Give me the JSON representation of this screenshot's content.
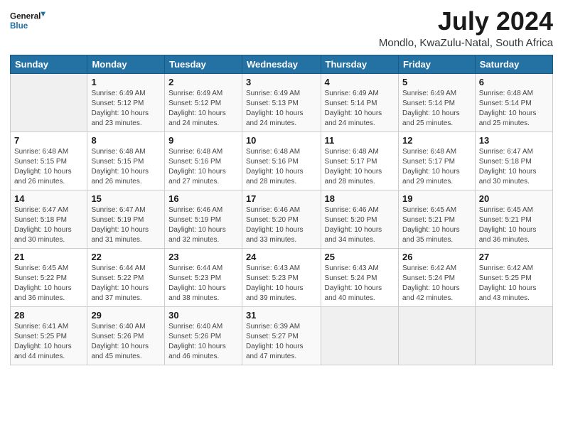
{
  "logo": {
    "text_general": "General",
    "text_blue": "Blue"
  },
  "title": "July 2024",
  "subtitle": "Mondlo, KwaZulu-Natal, South Africa",
  "days_of_week": [
    "Sunday",
    "Monday",
    "Tuesday",
    "Wednesday",
    "Thursday",
    "Friday",
    "Saturday"
  ],
  "weeks": [
    [
      {
        "day": "",
        "info": ""
      },
      {
        "day": "1",
        "info": "Sunrise: 6:49 AM\nSunset: 5:12 PM\nDaylight: 10 hours\nand 23 minutes."
      },
      {
        "day": "2",
        "info": "Sunrise: 6:49 AM\nSunset: 5:12 PM\nDaylight: 10 hours\nand 24 minutes."
      },
      {
        "day": "3",
        "info": "Sunrise: 6:49 AM\nSunset: 5:13 PM\nDaylight: 10 hours\nand 24 minutes."
      },
      {
        "day": "4",
        "info": "Sunrise: 6:49 AM\nSunset: 5:14 PM\nDaylight: 10 hours\nand 24 minutes."
      },
      {
        "day": "5",
        "info": "Sunrise: 6:49 AM\nSunset: 5:14 PM\nDaylight: 10 hours\nand 25 minutes."
      },
      {
        "day": "6",
        "info": "Sunrise: 6:48 AM\nSunset: 5:14 PM\nDaylight: 10 hours\nand 25 minutes."
      }
    ],
    [
      {
        "day": "7",
        "info": "Sunrise: 6:48 AM\nSunset: 5:15 PM\nDaylight: 10 hours\nand 26 minutes."
      },
      {
        "day": "8",
        "info": "Sunrise: 6:48 AM\nSunset: 5:15 PM\nDaylight: 10 hours\nand 26 minutes."
      },
      {
        "day": "9",
        "info": "Sunrise: 6:48 AM\nSunset: 5:16 PM\nDaylight: 10 hours\nand 27 minutes."
      },
      {
        "day": "10",
        "info": "Sunrise: 6:48 AM\nSunset: 5:16 PM\nDaylight: 10 hours\nand 28 minutes."
      },
      {
        "day": "11",
        "info": "Sunrise: 6:48 AM\nSunset: 5:17 PM\nDaylight: 10 hours\nand 28 minutes."
      },
      {
        "day": "12",
        "info": "Sunrise: 6:48 AM\nSunset: 5:17 PM\nDaylight: 10 hours\nand 29 minutes."
      },
      {
        "day": "13",
        "info": "Sunrise: 6:47 AM\nSunset: 5:18 PM\nDaylight: 10 hours\nand 30 minutes."
      }
    ],
    [
      {
        "day": "14",
        "info": "Sunrise: 6:47 AM\nSunset: 5:18 PM\nDaylight: 10 hours\nand 30 minutes."
      },
      {
        "day": "15",
        "info": "Sunrise: 6:47 AM\nSunset: 5:19 PM\nDaylight: 10 hours\nand 31 minutes."
      },
      {
        "day": "16",
        "info": "Sunrise: 6:46 AM\nSunset: 5:19 PM\nDaylight: 10 hours\nand 32 minutes."
      },
      {
        "day": "17",
        "info": "Sunrise: 6:46 AM\nSunset: 5:20 PM\nDaylight: 10 hours\nand 33 minutes."
      },
      {
        "day": "18",
        "info": "Sunrise: 6:46 AM\nSunset: 5:20 PM\nDaylight: 10 hours\nand 34 minutes."
      },
      {
        "day": "19",
        "info": "Sunrise: 6:45 AM\nSunset: 5:21 PM\nDaylight: 10 hours\nand 35 minutes."
      },
      {
        "day": "20",
        "info": "Sunrise: 6:45 AM\nSunset: 5:21 PM\nDaylight: 10 hours\nand 36 minutes."
      }
    ],
    [
      {
        "day": "21",
        "info": "Sunrise: 6:45 AM\nSunset: 5:22 PM\nDaylight: 10 hours\nand 36 minutes."
      },
      {
        "day": "22",
        "info": "Sunrise: 6:44 AM\nSunset: 5:22 PM\nDaylight: 10 hours\nand 37 minutes."
      },
      {
        "day": "23",
        "info": "Sunrise: 6:44 AM\nSunset: 5:23 PM\nDaylight: 10 hours\nand 38 minutes."
      },
      {
        "day": "24",
        "info": "Sunrise: 6:43 AM\nSunset: 5:23 PM\nDaylight: 10 hours\nand 39 minutes."
      },
      {
        "day": "25",
        "info": "Sunrise: 6:43 AM\nSunset: 5:24 PM\nDaylight: 10 hours\nand 40 minutes."
      },
      {
        "day": "26",
        "info": "Sunrise: 6:42 AM\nSunset: 5:24 PM\nDaylight: 10 hours\nand 42 minutes."
      },
      {
        "day": "27",
        "info": "Sunrise: 6:42 AM\nSunset: 5:25 PM\nDaylight: 10 hours\nand 43 minutes."
      }
    ],
    [
      {
        "day": "28",
        "info": "Sunrise: 6:41 AM\nSunset: 5:25 PM\nDaylight: 10 hours\nand 44 minutes."
      },
      {
        "day": "29",
        "info": "Sunrise: 6:40 AM\nSunset: 5:26 PM\nDaylight: 10 hours\nand 45 minutes."
      },
      {
        "day": "30",
        "info": "Sunrise: 6:40 AM\nSunset: 5:26 PM\nDaylight: 10 hours\nand 46 minutes."
      },
      {
        "day": "31",
        "info": "Sunrise: 6:39 AM\nSunset: 5:27 PM\nDaylight: 10 hours\nand 47 minutes."
      },
      {
        "day": "",
        "info": ""
      },
      {
        "day": "",
        "info": ""
      },
      {
        "day": "",
        "info": ""
      }
    ]
  ]
}
